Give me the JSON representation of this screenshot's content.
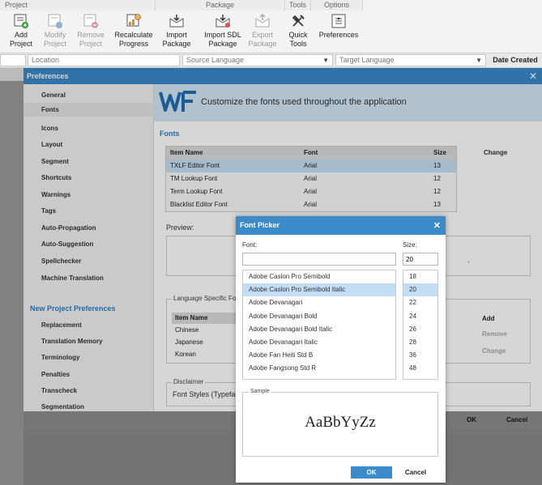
{
  "ribbon": {
    "groups": {
      "project": "Project",
      "package": "Package",
      "tools": "Tools",
      "options": "Options"
    },
    "buttons": {
      "add_project": "Add\nProject",
      "modify_project": "Modify\nProject",
      "remove_project": "Remove\nProject",
      "recalculate": "Recalculate\nProgress",
      "import_package": "Import\nPackage",
      "import_sdl": "Import SDL\nPackage",
      "export_package": "Export\nPackage",
      "quick_tools": "Quick\nTools",
      "preferences": "Preferences"
    }
  },
  "columns": {
    "location": "Location",
    "source_language": "Source Language",
    "target_language": "Target Language",
    "date_created": "Date Created"
  },
  "preferences": {
    "title": "Preferences",
    "banner": "Customize the fonts used throughout the application",
    "section_title": "Fonts",
    "nav": [
      "General",
      "Fonts",
      "Icons",
      "Layout",
      "Segment",
      "Shortcuts",
      "Warnings",
      "Tags",
      "Auto-Propagation",
      "Auto-Suggestion",
      "Spellchecker",
      "Machine Translation"
    ],
    "nav_heading": "New Project Preferences",
    "nav2": [
      "Replacement",
      "Translation Memory",
      "Terminology",
      "Penalties",
      "Transcheck",
      "Segmentation"
    ],
    "font_table": {
      "headers": {
        "name": "Item Name",
        "font": "Font",
        "size": "Size"
      },
      "rows": [
        {
          "name": "TXLF Editor Font",
          "font": "Arial",
          "size": "13"
        },
        {
          "name": "TM Lookup Font",
          "font": "Arial",
          "size": "12"
        },
        {
          "name": "Term Lookup Font",
          "font": "Arial",
          "size": "12"
        },
        {
          "name": "Blacklist Editor Font",
          "font": "Arial",
          "size": "13"
        }
      ]
    },
    "change": "Change",
    "preview_label": "Preview:",
    "preview_tail": ".",
    "lang_group_title": "Language Specific Font",
    "lang_table": {
      "header": "Item Name",
      "rows": [
        "Chinese",
        "Japanese",
        "Korean"
      ]
    },
    "add": "Add",
    "remove": "Remove",
    "change2": "Change",
    "disclaimer_title": "Disclaimer",
    "disclaimer_text": "Font Styles (Typefac",
    "ok": "OK",
    "cancel": "Cancel"
  },
  "font_picker": {
    "title": "Font Picker",
    "font_label": "Font:",
    "size_label": "Size:",
    "font_value": "",
    "size_value": "20",
    "fonts": [
      "Adobe Caslon Pro Semibold",
      "Adobe Caslon Pro Semibold Italic",
      "Adobe Devanagari",
      "Adobe Devanagari Bold",
      "Adobe Devanagari Bold Italic",
      "Adobe Devanagari Italic",
      "Adobe Fan Heiti Std B",
      "Adobe Fangsong Std R"
    ],
    "sizes": [
      "18",
      "20",
      "22",
      "24",
      "26",
      "28",
      "36",
      "48"
    ],
    "sample_title": "Sample",
    "sample_text": "AaBbYyZz",
    "ok": "OK",
    "cancel": "Cancel"
  },
  "colors": {
    "accent": "#3b8ac9",
    "selection": "#c3def4",
    "banner": "#d3e6f5"
  }
}
